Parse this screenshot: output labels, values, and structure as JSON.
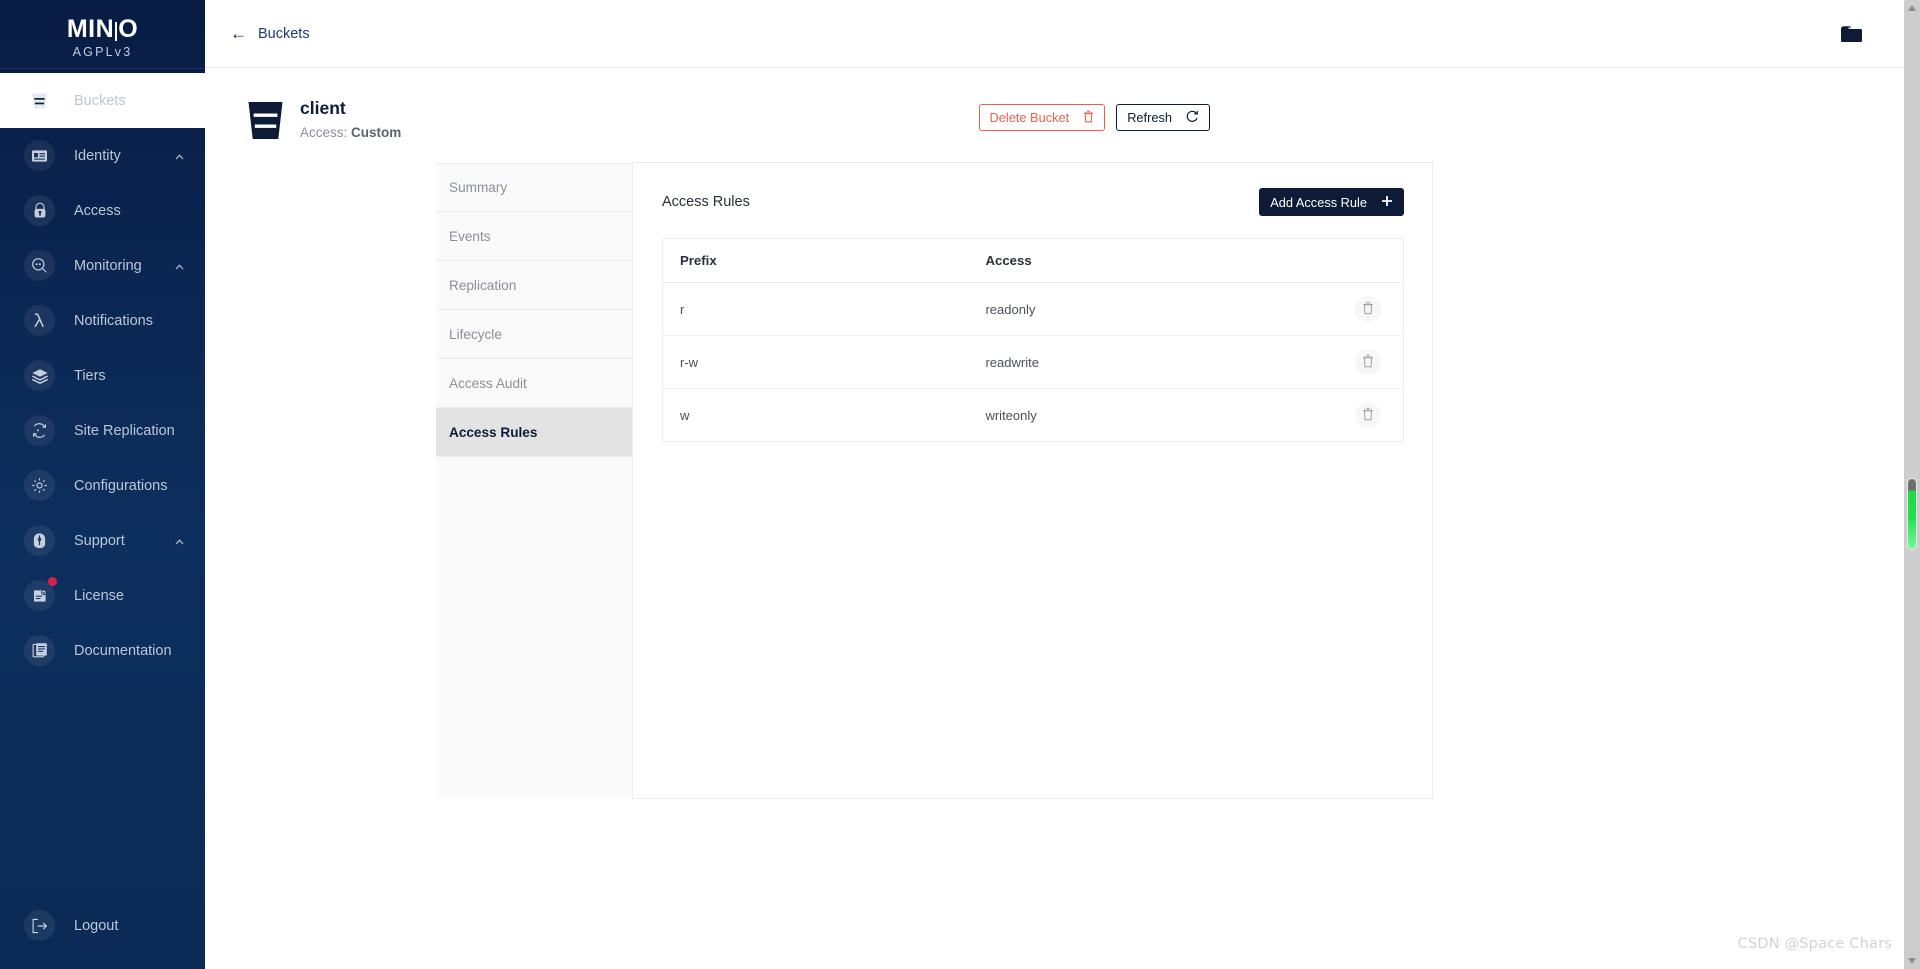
{
  "brand": {
    "name_part1": "MIN",
    "name_part2": "O",
    "license": "AGPLv3"
  },
  "sidebar": {
    "items": [
      {
        "label": "Buckets",
        "icon": "bucket-icon",
        "active": true,
        "chevron": "",
        "badge": false
      },
      {
        "label": "Identity",
        "icon": "identity-card-icon",
        "active": false,
        "chevron": "^",
        "badge": false
      },
      {
        "label": "Access",
        "icon": "lock-icon",
        "active": false,
        "chevron": "",
        "badge": false
      },
      {
        "label": "Monitoring",
        "icon": "magnifier-icon",
        "active": false,
        "chevron": "^",
        "badge": false
      },
      {
        "label": "Notifications",
        "icon": "lambda-icon",
        "active": false,
        "chevron": "",
        "badge": false
      },
      {
        "label": "Tiers",
        "icon": "layers-icon",
        "active": false,
        "chevron": "",
        "badge": false
      },
      {
        "label": "Site Replication",
        "icon": "sync-icon",
        "active": false,
        "chevron": "",
        "badge": false
      },
      {
        "label": "Configurations",
        "icon": "gear-icon",
        "active": false,
        "chevron": "",
        "badge": false
      },
      {
        "label": "Support",
        "icon": "headset-icon",
        "active": false,
        "chevron": "^",
        "badge": false
      },
      {
        "label": "License",
        "icon": "license-doc-icon",
        "active": false,
        "chevron": "",
        "badge": true
      },
      {
        "label": "Documentation",
        "icon": "book-icon",
        "active": false,
        "chevron": "",
        "badge": false
      }
    ],
    "logout": {
      "label": "Logout",
      "icon": "logout-icon"
    }
  },
  "topbar": {
    "collapse_icon": "panel-collapse-icon",
    "back_arrow": "←",
    "breadcrumb": "Buckets",
    "folder_icon": "folder-icon"
  },
  "bucket": {
    "icon": "bucket-large-icon",
    "name": "client",
    "access_label": "Access:",
    "access_value": "Custom",
    "actions": {
      "delete_label": "Delete Bucket",
      "delete_icon": "trash-icon",
      "refresh_label": "Refresh",
      "refresh_icon": "refresh-icon"
    }
  },
  "tabs": [
    {
      "label": "Summary",
      "active": false
    },
    {
      "label": "Events",
      "active": false
    },
    {
      "label": "Replication",
      "active": false
    },
    {
      "label": "Lifecycle",
      "active": false
    },
    {
      "label": "Access Audit",
      "active": false
    },
    {
      "label": "Access Rules",
      "active": true
    }
  ],
  "panel": {
    "title": "Access Rules",
    "add_button_label": "Add Access Rule",
    "add_button_icon": "plus-icon",
    "table": {
      "columns": [
        "Prefix",
        "Access",
        ""
      ],
      "rows": [
        {
          "prefix": "r",
          "access": "readonly",
          "delete_icon": "trash-icon"
        },
        {
          "prefix": "r-w",
          "access": "readwrite",
          "delete_icon": "trash-icon"
        },
        {
          "prefix": "w",
          "access": "writeonly",
          "delete_icon": "trash-icon"
        }
      ]
    }
  },
  "watermark": "CSDN @Space Chars",
  "colors": {
    "sidebar_top": "#081c44",
    "sidebar_bottom": "#0b2a55",
    "accent_dark": "#0d1b36",
    "danger": "#e8614d",
    "badge": "#d9214e",
    "tab_active_bg": "#e3e3e3",
    "scrollbar_track": "#cdcdcd",
    "scrollbar_thumb": "#22e04c"
  }
}
